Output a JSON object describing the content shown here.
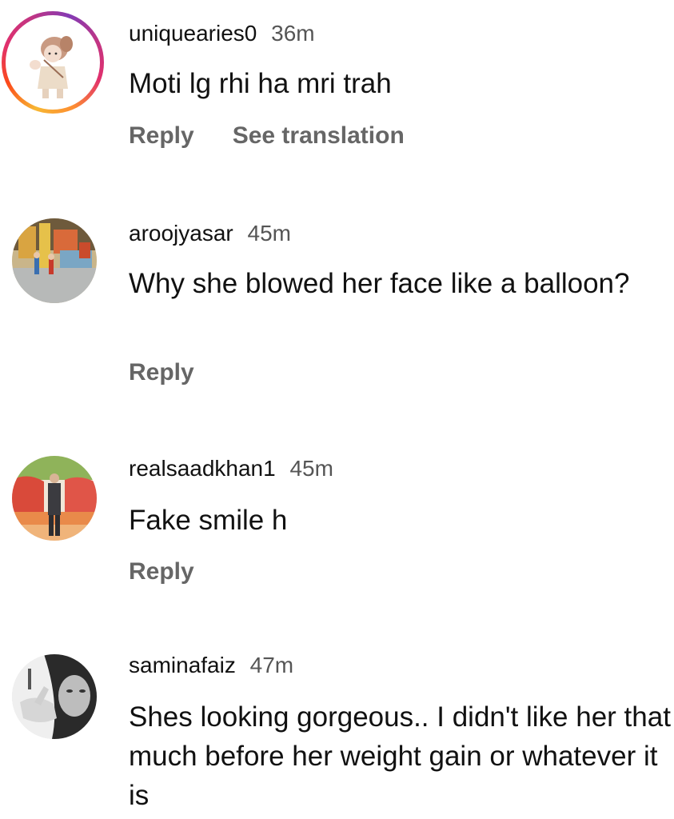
{
  "comments": [
    {
      "username": "uniquearies0",
      "time": "36m",
      "text": "Moti lg rhi ha mri trah",
      "reply_label": "Reply",
      "translate_label": "See translation",
      "avatar": "cartoon-girl-avatar",
      "has_story_ring": true
    },
    {
      "username": "aroojyasar",
      "time": "45m",
      "text": "Why she blowed her face like a balloon?",
      "reply_label": "Reply",
      "avatar": "playground-photo-avatar"
    },
    {
      "username": "realsaadkhan1",
      "time": "45m",
      "text": "Fake smile h",
      "reply_label": "Reply",
      "avatar": "man-standing-photo-avatar"
    },
    {
      "username": "saminafaiz",
      "time": "47m",
      "text": "Shes looking gorgeous.. I didn't like her that much before her weight gain or whatever it is",
      "avatar": "selfie-photo-avatar"
    }
  ],
  "colors": {
    "username": "#111111",
    "timestamp": "#555555",
    "action": "#666666",
    "story_ring": [
      "#f7b733",
      "#fc4a1a",
      "#e1306c",
      "#c13584",
      "#833ab4"
    ]
  }
}
